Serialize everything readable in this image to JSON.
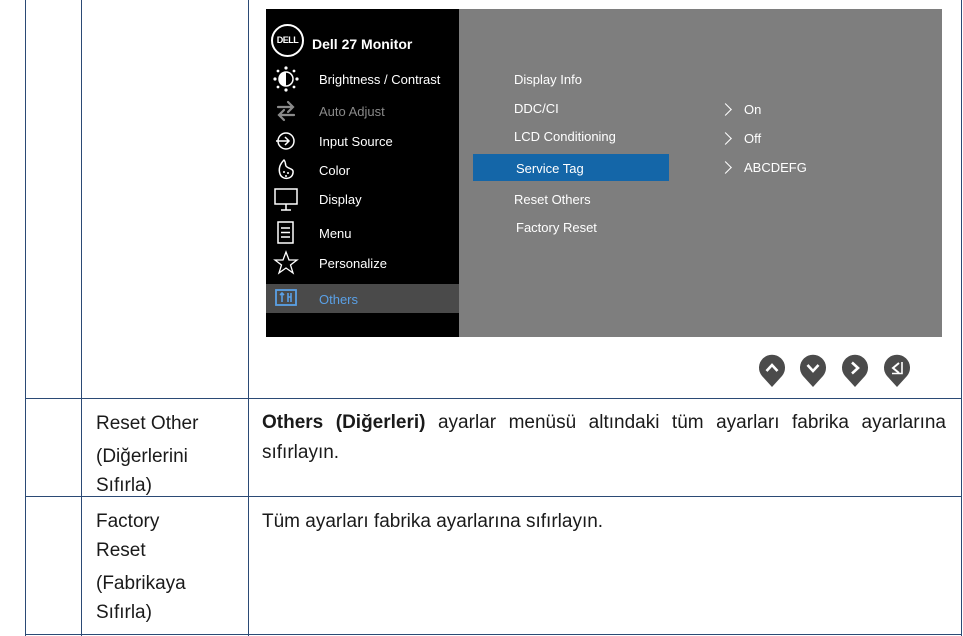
{
  "osd": {
    "title": "Dell 27 Monitor",
    "logo": "DELL",
    "menu": [
      {
        "label": "Brightness / Contrast",
        "icon": "brightness-icon",
        "state": "normal"
      },
      {
        "label": "Auto Adjust",
        "icon": "auto-adjust-icon",
        "state": "disabled"
      },
      {
        "label": "Input Source",
        "icon": "input-source-icon",
        "state": "normal"
      },
      {
        "label": "Color",
        "icon": "color-icon",
        "state": "normal"
      },
      {
        "label": "Display",
        "icon": "display-icon",
        "state": "normal"
      },
      {
        "label": "Menu",
        "icon": "menu-icon",
        "state": "normal"
      },
      {
        "label": "Personalize",
        "icon": "star-icon",
        "state": "normal"
      },
      {
        "label": "Others",
        "icon": "others-icon",
        "state": "selected"
      }
    ],
    "submenu": [
      "Display Info",
      "DDC/CI",
      "LCD Conditioning",
      "Service Tag",
      "Reset Others",
      "Factory Reset"
    ],
    "values": [
      "On",
      "Off",
      "ABCDEFG"
    ],
    "selected_color": "#1466a8"
  },
  "nav_buttons": [
    "up-icon",
    "down-icon",
    "right-icon",
    "back-icon"
  ],
  "rows": [
    {
      "name_lines": [
        "Reset Other",
        "(Diğerlerini",
        "Sıfırla)"
      ],
      "desc_bold": "Others (Diğerleri)",
      "desc_rest": " ayarlar menüsü altındaki tüm ayarları fabrika ayarlarına sıfırlayın."
    },
    {
      "name_lines": [
        "Factory",
        "Reset",
        "(Fabrikaya",
        "Sıfırla)"
      ],
      "desc_rest": "Tüm ayarları fabrika ayarlarına sıfırlayın."
    }
  ]
}
